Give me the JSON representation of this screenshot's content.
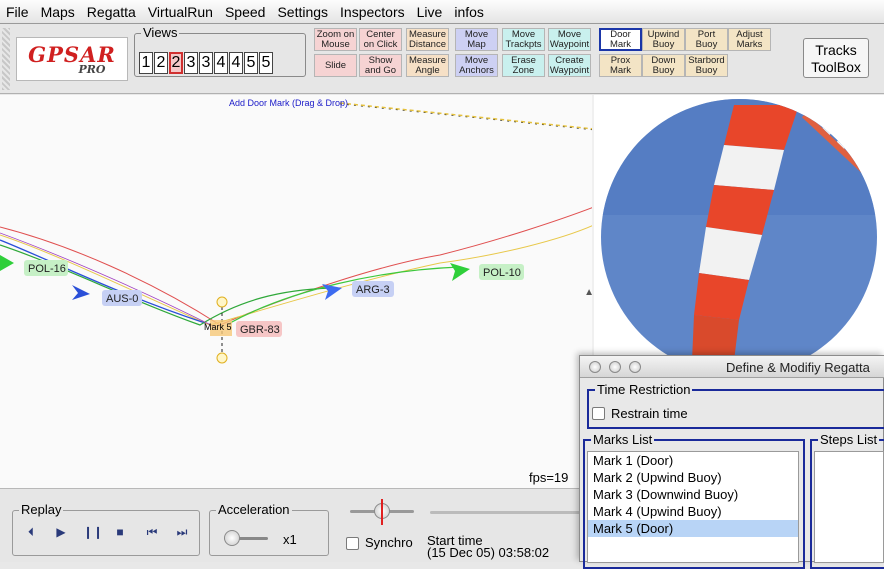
{
  "menu": [
    "File",
    "Maps",
    "Regatta",
    "VirtualRun",
    "Speed",
    "Settings",
    "Inspectors",
    "Live",
    "infos"
  ],
  "logo": {
    "main": "GPSAR",
    "sub": "PRO"
  },
  "views": {
    "title": "Views",
    "buttons": [
      "1",
      "2",
      "2",
      "3",
      "3",
      "4",
      "4",
      "5",
      "5"
    ],
    "active_index": 2
  },
  "toolbar": {
    "zoom_on_mouse": "Zoom on Mouse",
    "center_on_click": "Center on Click",
    "measure_distance": "Measure Distance",
    "move_map": "Move Map",
    "move_trackpts": "Move Trackpts",
    "move_waypoint": "Move Waypoint",
    "door_mark": "Door Mark",
    "upwind_buoy": "Upwind Buoy",
    "port_buoy": "Port Buoy",
    "adjust_marks": "Adjust Marks",
    "slide": "Slide",
    "show_and_go": "Show and Go",
    "measure_angle": "Measure Angle",
    "move_anchors": "Move Anchors",
    "erase_zone": "Erase Zone",
    "create_waypoint": "Create Waypoint",
    "prox_mark": "Prox Mark",
    "down_buoy": "Down Buoy",
    "starboard_buoy": "Starbord Buoy",
    "tracks_toolbox": "Tracks ToolBox"
  },
  "map": {
    "hint": "Add Door Mark (Drag & Drop)",
    "mark_label": "Mark 5",
    "boats": {
      "pol16": "POL-16",
      "aus0": "AUS-0",
      "arg3": "ARG-3",
      "pol10": "POL-10",
      "gbr83": "GBR-83"
    },
    "fps": "fps=19"
  },
  "replay": {
    "title": "Replay",
    "controls": [
      "⏴",
      "▶",
      "❙❙",
      "■",
      "⏮",
      "⏭"
    ]
  },
  "acceleration": {
    "title": "Acceleration",
    "value": "x1"
  },
  "synchro": {
    "label": "Synchro",
    "start_time_label": "Start time",
    "start_time_value": "(15 Dec 05) 03:58:02"
  },
  "dialog": {
    "title": "Define & Modifiy Regatta",
    "time_restriction": "Time Restriction",
    "restrain_time": "Restrain time",
    "marks_list_title": "Marks List",
    "steps_list_title": "Steps List",
    "marks": [
      "Mark 1 (Door)",
      "Mark 2 (Upwind Buoy)",
      "Mark 3 (Downwind Buoy)",
      "Mark 4 (Upwind Buoy)",
      "Mark 5 (Door)"
    ],
    "selected_mark_index": 4
  },
  "colors": {
    "selected_border": "#1b36a8",
    "list_selection": "#b8d4f6",
    "boat_blue": "#2a4fd8",
    "boat_green": "#2fcf3a"
  }
}
